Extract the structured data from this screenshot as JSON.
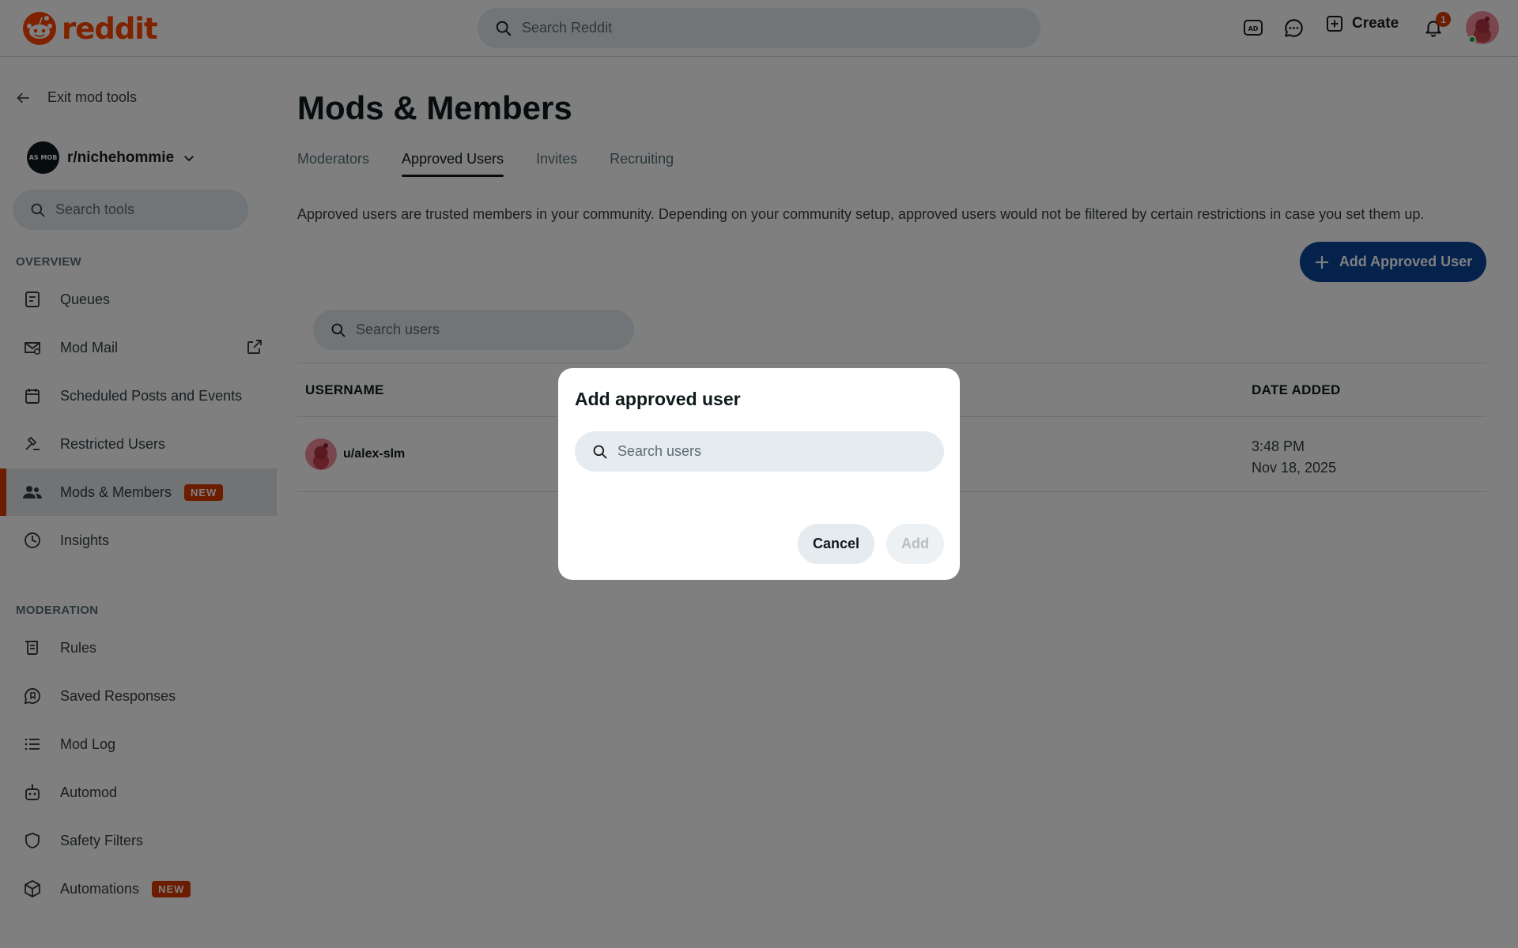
{
  "header": {
    "logo_text": "reddit",
    "search_placeholder": "Search Reddit",
    "create_label": "Create",
    "notification_count": "1"
  },
  "sidebar": {
    "exit_label": "Exit mod tools",
    "subreddit": "r/nichehommie",
    "subreddit_avatar_text": "AS MOB",
    "search_placeholder": "Search tools",
    "overview_label": "OVERVIEW",
    "moderation_label": "MODERATION",
    "new_badge": "NEW",
    "overview_items": [
      {
        "label": "Queues",
        "icon": "queue-icon"
      },
      {
        "label": "Mod Mail",
        "icon": "mail-icon"
      },
      {
        "label": "Scheduled Posts and Events",
        "icon": "calendar-icon"
      },
      {
        "label": "Restricted Users",
        "icon": "hammer-icon"
      },
      {
        "label": "Mods & Members",
        "icon": "members-icon",
        "active": true,
        "badge": "NEW"
      },
      {
        "label": "Insights",
        "icon": "insights-icon"
      }
    ],
    "moderation_items": [
      {
        "label": "Rules",
        "icon": "rules-icon"
      },
      {
        "label": "Saved Responses",
        "icon": "saved-responses-icon"
      },
      {
        "label": "Mod Log",
        "icon": "list-icon"
      },
      {
        "label": "Automod",
        "icon": "robot-icon"
      },
      {
        "label": "Safety Filters",
        "icon": "shield-icon"
      },
      {
        "label": "Automations",
        "icon": "cube-icon",
        "badge": "NEW"
      }
    ]
  },
  "main": {
    "title": "Mods & Members",
    "tabs": [
      {
        "label": "Moderators"
      },
      {
        "label": "Approved Users",
        "active": true
      },
      {
        "label": "Invites"
      },
      {
        "label": "Recruiting"
      }
    ],
    "description": "Approved users are trusted members in your community. Depending on your community setup, approved users would not be filtered by certain restrictions in case you set them up.",
    "add_button_label": "Add Approved User",
    "users_search_placeholder": "Search users",
    "table": {
      "headers": {
        "username": "USERNAME",
        "date_added": "DATE ADDED"
      },
      "rows": [
        {
          "username": "u/alex-slm",
          "time": "3:48 PM",
          "date": "Nov 18, 2025"
        }
      ]
    }
  },
  "modal": {
    "title": "Add approved user",
    "search_placeholder": "Search users",
    "cancel_label": "Cancel",
    "add_label": "Add"
  },
  "colors": {
    "brand": "#ff4500",
    "primary_button": "#0a449b",
    "badge": "#d93a00",
    "overlay": "rgba(0,0,0,0.5)"
  }
}
